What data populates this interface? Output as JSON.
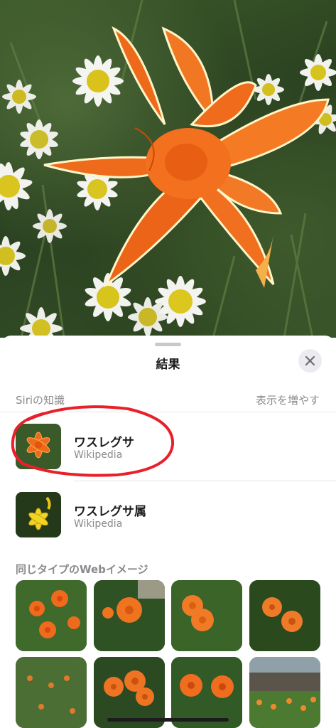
{
  "photo": {
    "subject": "orange day lily among white daisies",
    "icon": "flower-photo"
  },
  "sheet": {
    "title": "結果",
    "close_icon": "close-icon"
  },
  "siri_knowledge": {
    "label": "Siriの知識",
    "more_label": "表示を増やす",
    "items": [
      {
        "title": "ワスレグサ",
        "subtitle": "Wikipedia"
      },
      {
        "title": "ワスレグサ属",
        "subtitle": "Wikipedia"
      }
    ]
  },
  "web_images": {
    "label": "同じタイプのWebイメージ",
    "count": 8
  },
  "colors": {
    "accent_annotation": "#e8202a",
    "lily_orange": "#f26a1b",
    "secondary_text": "#8a8a8e"
  }
}
